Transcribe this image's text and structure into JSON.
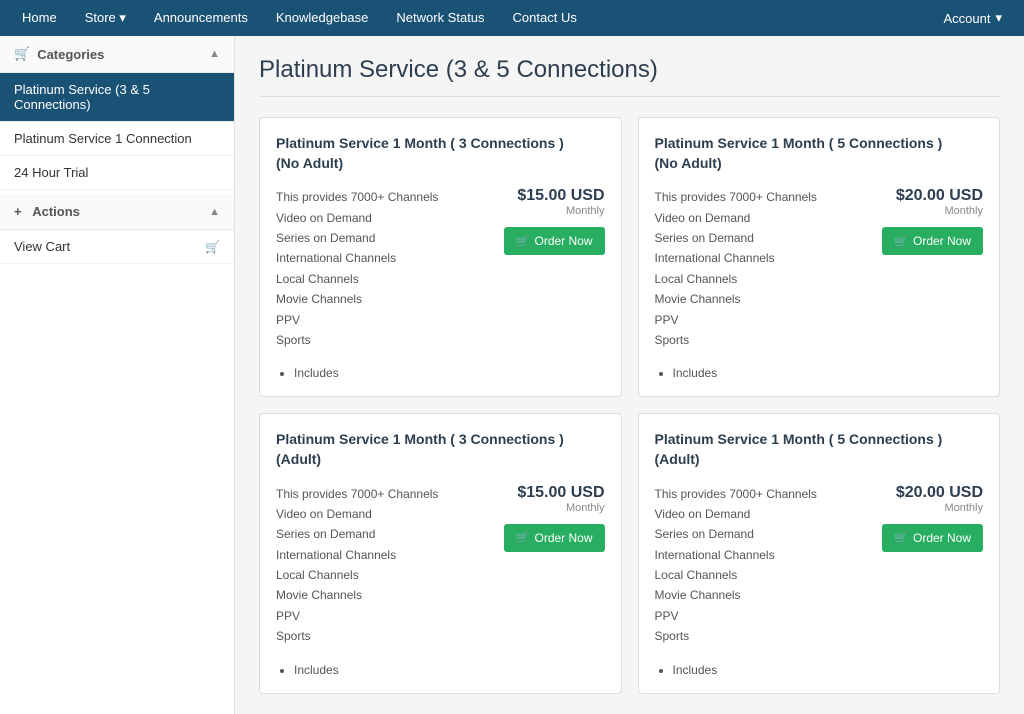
{
  "nav": {
    "items": [
      {
        "id": "home",
        "label": "Home",
        "active": false
      },
      {
        "id": "store",
        "label": "Store",
        "hasDropdown": true,
        "active": false
      },
      {
        "id": "announcements",
        "label": "Announcements",
        "active": false
      },
      {
        "id": "knowledgebase",
        "label": "Knowledgebase",
        "active": false
      },
      {
        "id": "network-status",
        "label": "Network Status",
        "active": false
      },
      {
        "id": "contact-us",
        "label": "Contact Us",
        "active": false
      }
    ],
    "account": {
      "label": "Account",
      "hasDropdown": true
    }
  },
  "sidebar": {
    "categories_label": "Categories",
    "categories_icon": "🛒",
    "categories_chevron": "▲",
    "items": [
      {
        "id": "platinum-3-5",
        "label": "Platinum Service (3 & 5 Connections)",
        "active": true
      },
      {
        "id": "platinum-1",
        "label": "Platinum Service 1 Connection",
        "active": false
      },
      {
        "id": "24-hour",
        "label": "24 Hour Trial",
        "active": false
      }
    ],
    "actions_label": "Actions",
    "actions_icon": "+",
    "actions_chevron": "▲",
    "action_items": [
      {
        "id": "view-cart",
        "label": "View Cart",
        "hasIcon": true
      }
    ]
  },
  "page": {
    "title": "Platinum Service (3 & 5 Connections)"
  },
  "products": [
    {
      "id": "p1",
      "title": "Platinum Service 1 Month ( 3 Connections )\n(No Adult)",
      "features": [
        "This provides 7000+ Channels",
        "Video on Demand",
        "Series on Demand",
        "International Channels",
        "Local Channels",
        "Movie Channels",
        "PPV",
        "Sports"
      ],
      "price": "$15.00 USD",
      "period": "Monthly",
      "order_label": "Order Now",
      "includes_label": "Includes"
    },
    {
      "id": "p2",
      "title": "Platinum Service 1 Month ( 5 Connections )\n(No Adult)",
      "features": [
        "This provides 7000+ Channels",
        "Video on Demand",
        "Series on Demand",
        "International Channels",
        "Local Channels",
        "Movie Channels",
        "PPV",
        "Sports"
      ],
      "price": "$20.00 USD",
      "period": "Monthly",
      "order_label": "Order Now",
      "includes_label": "Includes"
    },
    {
      "id": "p3",
      "title": "Platinum Service 1 Month ( 3 Connections )\n(Adult)",
      "features": [
        "This provides 7000+ Channels",
        "Video on Demand",
        "Series on Demand",
        "International Channels",
        "Local Channels",
        "Movie Channels",
        "PPV",
        "Sports"
      ],
      "price": "$15.00 USD",
      "period": "Monthly",
      "order_label": "Order Now",
      "includes_label": "Includes"
    },
    {
      "id": "p4",
      "title": "Platinum Service 1 Month ( 5 Connections )\n(Adult)",
      "features": [
        "This provides 7000+ Channels",
        "Video on Demand",
        "Series on Demand",
        "International Channels",
        "Local Channels",
        "Movie Channels",
        "PPV",
        "Sports"
      ],
      "price": "$20.00 USD",
      "period": "Monthly",
      "order_label": "Order Now",
      "includes_label": "Includes"
    }
  ]
}
